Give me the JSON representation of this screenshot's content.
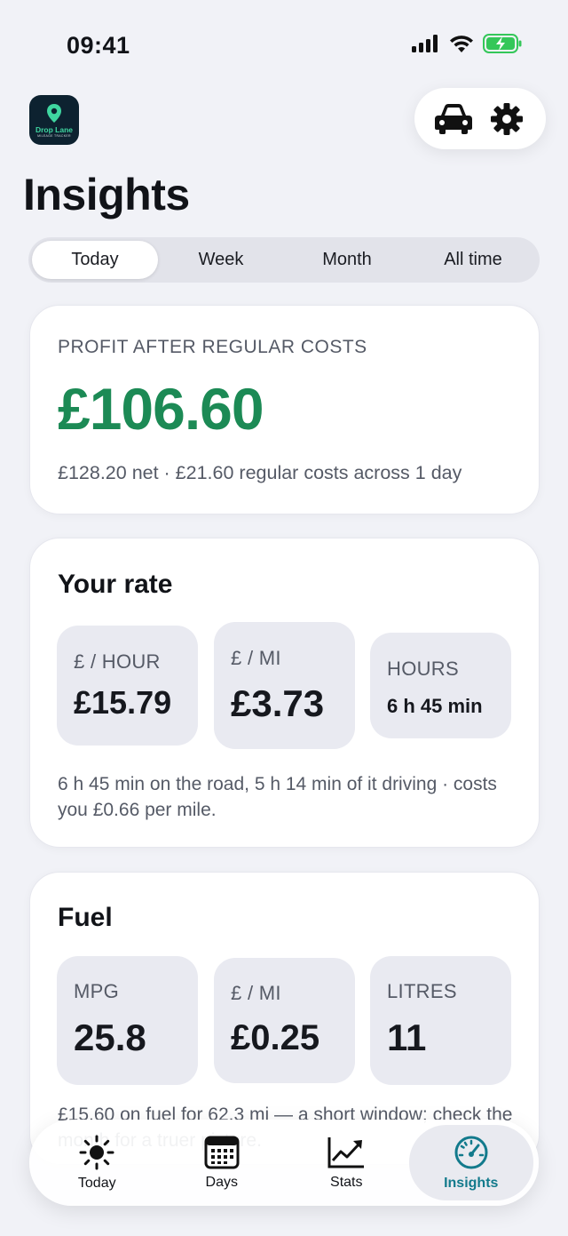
{
  "status": {
    "time": "09:41"
  },
  "logo": {
    "name": "Drop Lane",
    "tagline": "MILEAGE TRACKER"
  },
  "header": {
    "title": "Insights"
  },
  "range_tabs": [
    "Today",
    "Week",
    "Month",
    "All time"
  ],
  "active_range": "Today",
  "profit": {
    "label": "PROFIT AFTER REGULAR COSTS",
    "value": "£106.60",
    "subtitle": "£128.20 net · £21.60 regular costs across 1 day"
  },
  "rate": {
    "title": "Your rate",
    "tiles": [
      {
        "label": "£ / HOUR",
        "value": "£15.79"
      },
      {
        "label": "£ / MI",
        "value": "£3.73"
      },
      {
        "label": "HOURS",
        "value": "6 h 45 min"
      }
    ],
    "note": "6 h 45 min on the road, 5 h 14 min of it driving · costs you £0.66 per mile."
  },
  "fuel": {
    "title": "Fuel",
    "tiles": [
      {
        "label": "MPG",
        "value": "25.8"
      },
      {
        "label": "£ / MI",
        "value": "£0.25"
      },
      {
        "label": "LITRES",
        "value": "11"
      }
    ],
    "note": "£15.60 on fuel for 62.3 mi — a short window; check the month for a truer picture."
  },
  "tabbar": {
    "items": [
      {
        "label": "Today",
        "icon": "sun-icon"
      },
      {
        "label": "Days",
        "icon": "calendar-icon"
      },
      {
        "label": "Stats",
        "icon": "chart-icon"
      },
      {
        "label": "Insights",
        "icon": "gauge-icon"
      }
    ],
    "active": "Insights"
  },
  "colors": {
    "profit": "#1c8a55",
    "accent": "#127a8c",
    "battery": "#34c759"
  }
}
